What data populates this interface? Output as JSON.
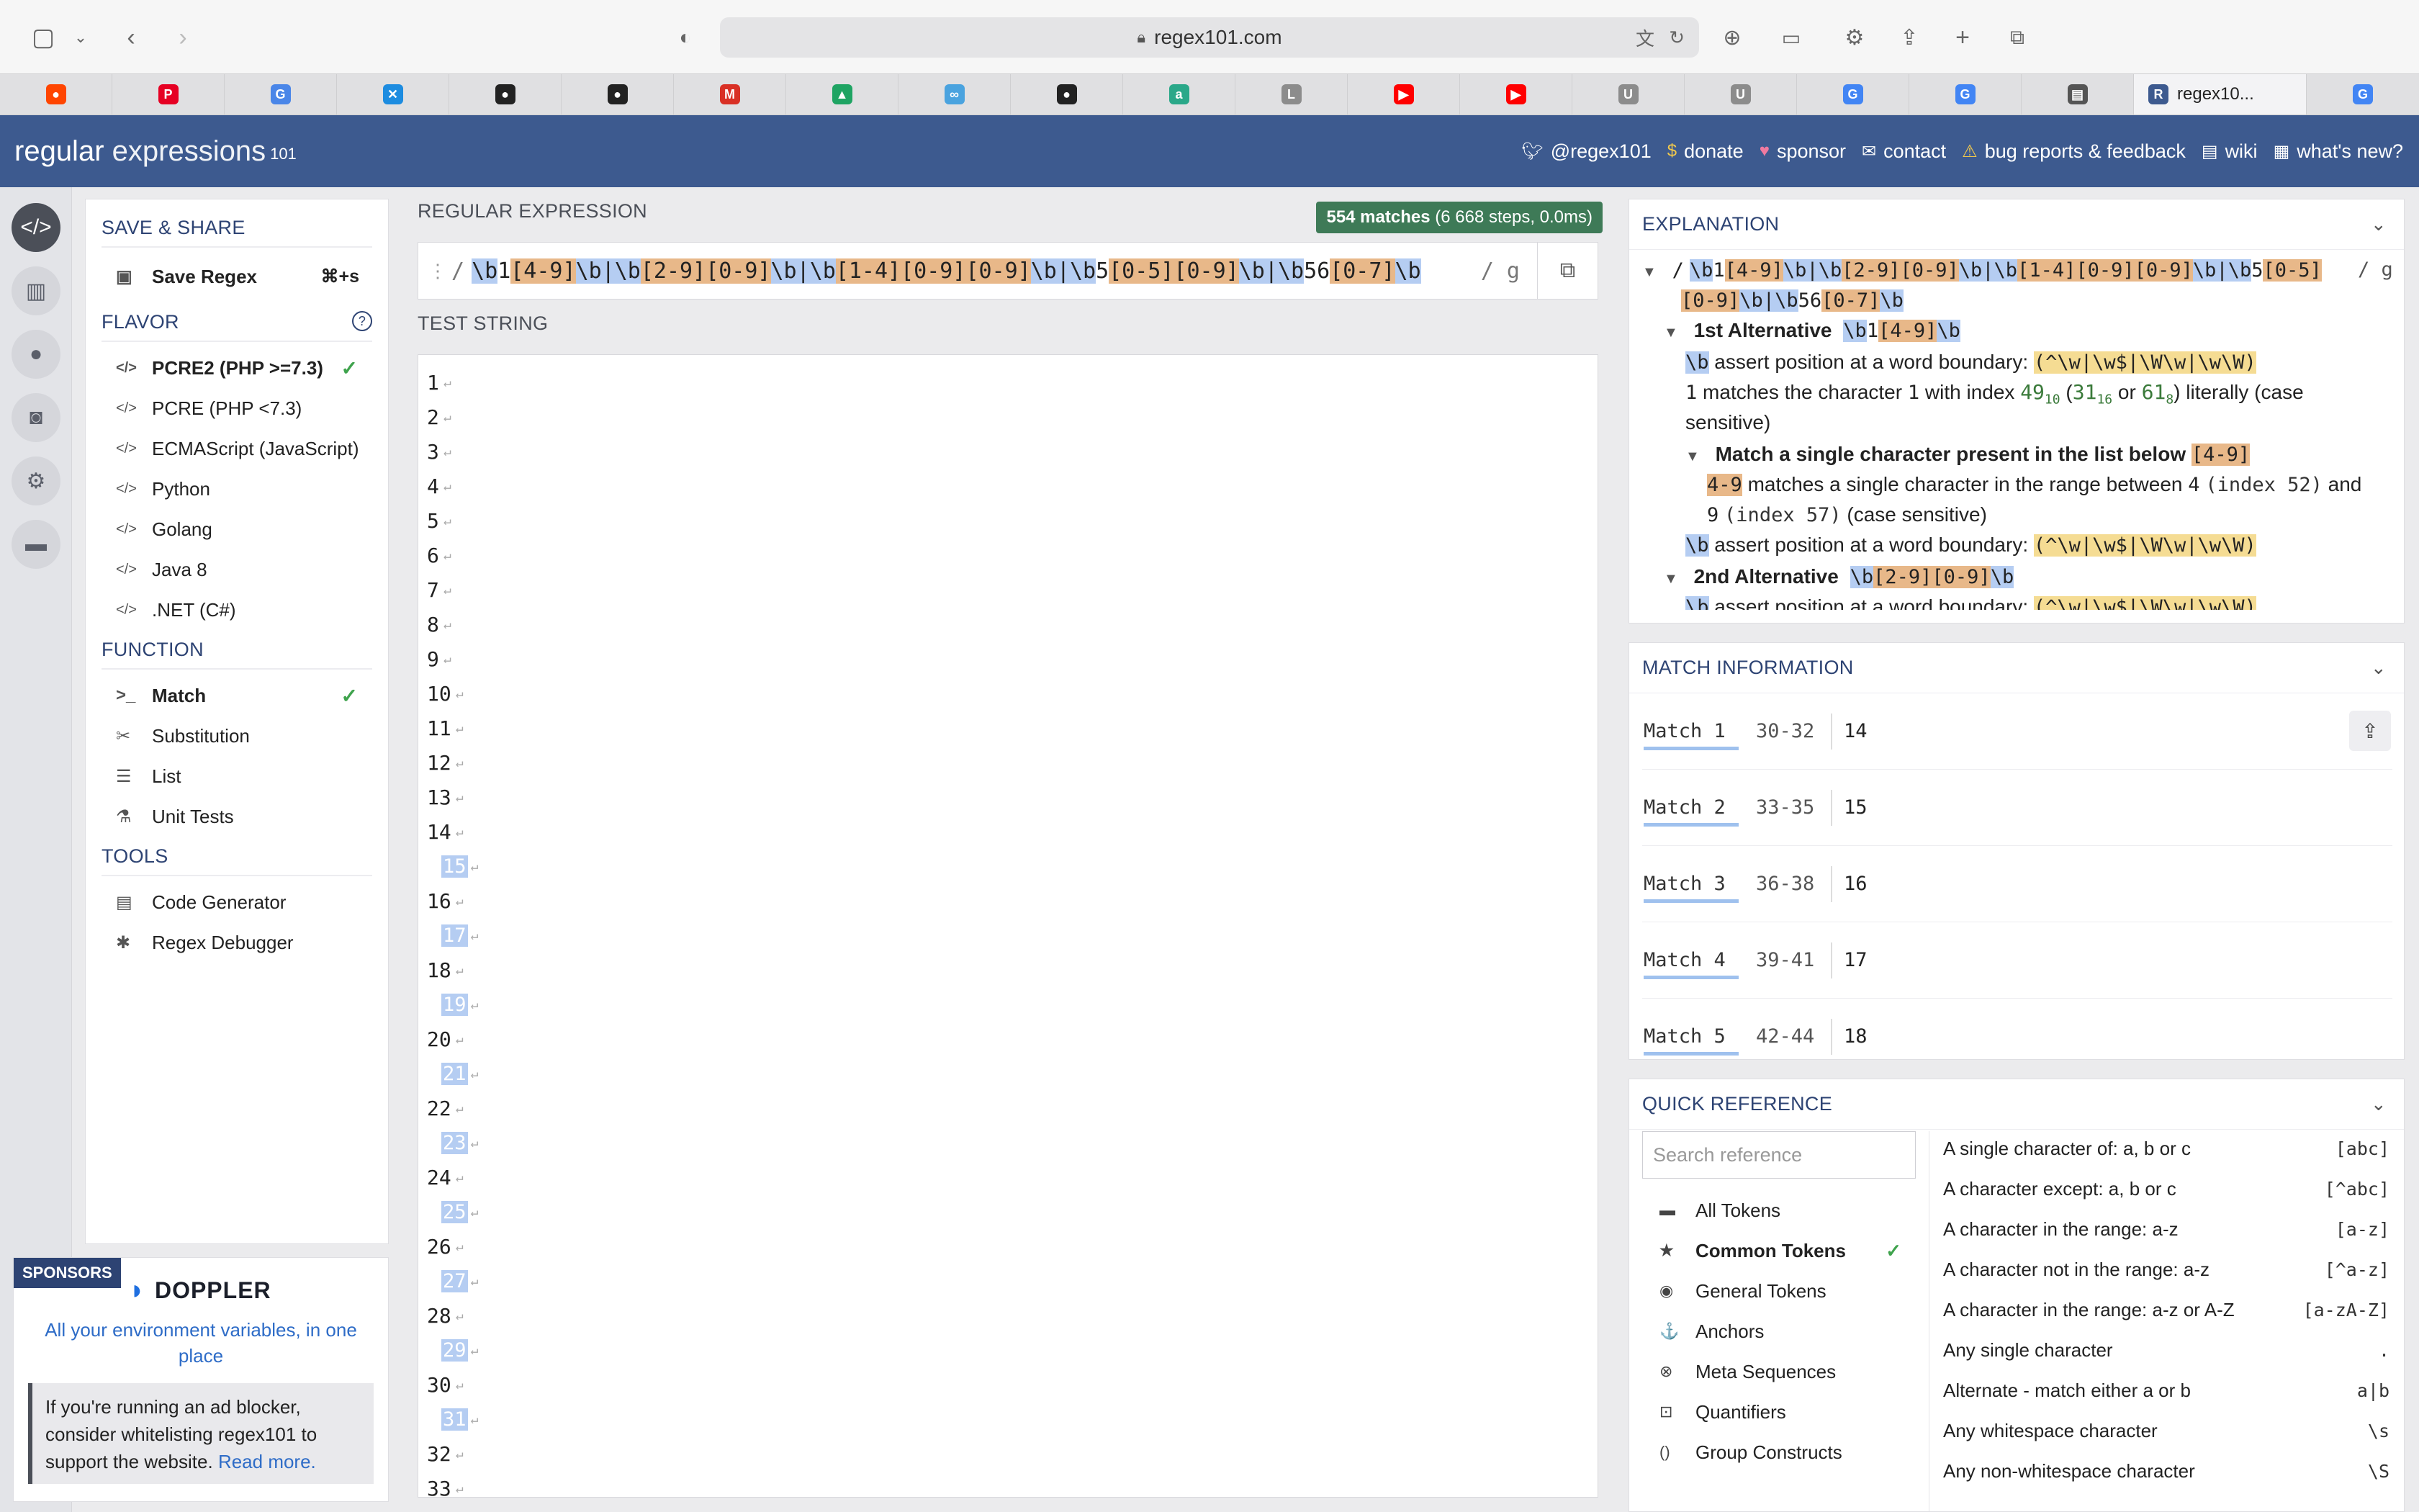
{
  "browser": {
    "url": "regex101.com",
    "active_tab_label": "regex10...",
    "tabs": [
      {
        "icon": "reddit-icon",
        "color": "#ff4500",
        "glyph": "●"
      },
      {
        "icon": "pinterest-icon",
        "color": "#e60023",
        "glyph": "P"
      },
      {
        "icon": "translate-icon",
        "color": "#4a86e8",
        "glyph": "G"
      },
      {
        "icon": "close-circle-icon",
        "color": "#1d8ce0",
        "glyph": "✕"
      },
      {
        "icon": "github-icon",
        "color": "#222222",
        "glyph": "●"
      },
      {
        "icon": "github-icon",
        "color": "#222222",
        "glyph": "●"
      },
      {
        "icon": "gmail-icon",
        "color": "#d93025",
        "glyph": "M"
      },
      {
        "icon": "drive-icon",
        "color": "#1fa463",
        "glyph": "▲"
      },
      {
        "icon": "link-icon",
        "color": "#4aa3df",
        "glyph": "∞"
      },
      {
        "icon": "github-icon",
        "color": "#222222",
        "glyph": "●"
      },
      {
        "icon": "app-icon",
        "color": "#2aa889",
        "glyph": "a"
      },
      {
        "icon": "letter-l-icon",
        "color": "#8c8c8c",
        "glyph": "L"
      },
      {
        "icon": "youtube-icon",
        "color": "#ff0000",
        "glyph": "▶"
      },
      {
        "icon": "youtube-icon",
        "color": "#ff0000",
        "glyph": "▶"
      },
      {
        "icon": "letter-u-icon",
        "color": "#8c8c8c",
        "glyph": "U"
      },
      {
        "icon": "letter-u-icon",
        "color": "#8c8c8c",
        "glyph": "U"
      },
      {
        "icon": "google-icon",
        "color": "#4285f4",
        "glyph": "G"
      },
      {
        "icon": "google-icon",
        "color": "#4285f4",
        "glyph": "G"
      },
      {
        "icon": "document-icon",
        "color": "#555555",
        "glyph": "▤"
      }
    ],
    "trailing_tab": {
      "icon": "google-icon",
      "color": "#4285f4",
      "glyph": "G"
    }
  },
  "header": {
    "logo_bold": "regular",
    "logo_rest": "expressions",
    "logo_sup": "101",
    "links": [
      {
        "icon": "twitter-icon",
        "label": "@regex101"
      },
      {
        "icon": "dollar-icon",
        "label": "donate"
      },
      {
        "icon": "heart-icon",
        "label": "sponsor"
      },
      {
        "icon": "mail-icon",
        "label": "contact"
      },
      {
        "icon": "warning-icon",
        "label": "bug reports & feedback"
      },
      {
        "icon": "wiki-icon",
        "label": "wiki"
      },
      {
        "icon": "news-icon",
        "label": "what's new?"
      }
    ]
  },
  "left_panel": {
    "save_title": "SAVE & SHARE",
    "save_regex": "Save Regex",
    "save_shortcut": "⌘+s",
    "flavor_title": "FLAVOR",
    "flavors": [
      "PCRE2 (PHP >=7.3)",
      "PCRE (PHP <7.3)",
      "ECMAScript (JavaScript)",
      "Python",
      "Golang",
      "Java 8",
      ".NET (C#)"
    ],
    "function_title": "FUNCTION",
    "functions": [
      "Match",
      "Substitution",
      "List",
      "Unit Tests"
    ],
    "tools_title": "TOOLS",
    "tools": [
      "Code Generator",
      "Regex Debugger"
    ]
  },
  "sponsor": {
    "badge": "SPONSORS",
    "name": "DOPPLER",
    "tagline": "All your environment variables, in one place",
    "adblock_text": "If you're running an ad blocker, consider whitelisting regex101 to support the website.",
    "adblock_link": "Read more."
  },
  "regex": {
    "label": "REGULAR EXPRESSION",
    "matches_count": "554 matches",
    "matches_detail": "(6 668 steps, 0.0ms)",
    "delimiter": "/",
    "flags": "/ g",
    "pattern_tokens": [
      {
        "t": "\\b",
        "c": "b"
      },
      {
        "t": "1",
        "c": ""
      },
      {
        "t": "[4-9]",
        "c": "c"
      },
      {
        "t": "\\b",
        "c": "b"
      },
      {
        "t": "|",
        "c": "b"
      },
      {
        "t": "\\b",
        "c": "b"
      },
      {
        "t": "[2-9]",
        "c": "c"
      },
      {
        "t": "[0-9]",
        "c": "c"
      },
      {
        "t": "\\b",
        "c": "b"
      },
      {
        "t": "|",
        "c": "b"
      },
      {
        "t": "\\b",
        "c": "b"
      },
      {
        "t": "[1-4]",
        "c": "c"
      },
      {
        "t": "[0-9]",
        "c": "c"
      },
      {
        "t": "[0-9]",
        "c": "c"
      },
      {
        "t": "\\b",
        "c": "b"
      },
      {
        "t": "|",
        "c": "b"
      },
      {
        "t": "\\b",
        "c": "b"
      },
      {
        "t": "5",
        "c": ""
      },
      {
        "t": "[0-5]",
        "c": "c"
      },
      {
        "t": "[0-9]",
        "c": "c"
      },
      {
        "t": "\\b",
        "c": "b"
      },
      {
        "t": "|",
        "c": "b"
      },
      {
        "t": "\\b",
        "c": "b"
      },
      {
        "t": "56",
        "c": ""
      },
      {
        "t": "[0-7]",
        "c": "c"
      },
      {
        "t": "\\b",
        "c": "b"
      }
    ]
  },
  "test_string": {
    "label": "TEST STRING",
    "lines": [
      "1",
      "2",
      "3",
      "4",
      "5",
      "6",
      "7",
      "8",
      "9",
      "10",
      "11",
      "12",
      "13",
      "14",
      "15",
      "16",
      "17",
      "18",
      "19",
      "20",
      "21",
      "22",
      "23",
      "24",
      "25",
      "26",
      "27",
      "28",
      "29",
      "30",
      "31",
      "32",
      "33"
    ],
    "highlighted": [
      "15",
      "17",
      "19",
      "21",
      "23",
      "25",
      "27",
      "29",
      "31"
    ]
  },
  "explanation": {
    "title": "EXPLANATION",
    "line1_tokens_a": [
      {
        "t": "\\b",
        "c": "b"
      },
      {
        "t": "1",
        "c": ""
      },
      {
        "t": "[4-9]",
        "c": "c"
      },
      {
        "t": "\\b",
        "c": "b"
      },
      {
        "t": "|",
        "c": "b"
      },
      {
        "t": "\\b",
        "c": "b"
      },
      {
        "t": "[2-9]",
        "c": "c"
      },
      {
        "t": "[0-9]",
        "c": "c"
      },
      {
        "t": "\\b",
        "c": "b"
      },
      {
        "t": "|",
        "c": "b"
      },
      {
        "t": "\\b",
        "c": "b"
      },
      {
        "t": "[1-4]",
        "c": "c"
      },
      {
        "t": "[0-9]",
        "c": "c"
      },
      {
        "t": "[0-9]",
        "c": "c"
      },
      {
        "t": "\\b",
        "c": "b"
      },
      {
        "t": "|",
        "c": "b"
      },
      {
        "t": "\\b",
        "c": "b"
      },
      {
        "t": "5",
        "c": ""
      },
      {
        "t": "[0-5]",
        "c": "c"
      }
    ],
    "line1_tokens_b": [
      {
        "t": "[0-9]",
        "c": "c"
      },
      {
        "t": "\\b",
        "c": "b"
      },
      {
        "t": "|",
        "c": "b"
      },
      {
        "t": "\\b",
        "c": "b"
      },
      {
        "t": "56",
        "c": ""
      },
      {
        "t": "[0-7]",
        "c": "c"
      },
      {
        "t": "\\b",
        "c": "b"
      }
    ],
    "flags": "/ g",
    "alt1_title": "1st Alternative",
    "alt1_tokens": [
      {
        "t": "\\b",
        "c": "b"
      },
      {
        "t": "1",
        "c": ""
      },
      {
        "t": "[4-9]",
        "c": "c"
      },
      {
        "t": "\\b",
        "c": "b"
      }
    ],
    "wb_token": "\\b",
    "wb_text": "assert position at a word boundary:",
    "wb_expr": "(^\\w|\\w$|\\W\\w|\\w\\W)",
    "lit_char": "1",
    "lit_text_a": "matches the character",
    "lit_char2": "1",
    "lit_text_b": "with index",
    "lit_dec": "49",
    "lit_dec_sub": "10",
    "lit_hex": "31",
    "lit_hex_sub": "16",
    "lit_or": "or",
    "lit_oct": "61",
    "lit_oct_sub": "8",
    "lit_text_c": "literally (case",
    "lit_text_d": "sensitive)",
    "list_title": "Match a single character present in the list below",
    "list_token": "[4-9]",
    "range_token": "4-9",
    "range_text_a": "matches a single character in the range between",
    "range_from": "4",
    "range_from_idx": "(index 52)",
    "range_and": "and",
    "range_to": "9",
    "range_to_idx": "(index 57)",
    "range_case": "(case sensitive)",
    "alt2_title": "2nd Alternative",
    "alt2_tokens": [
      {
        "t": "\\b",
        "c": "b"
      },
      {
        "t": "[2-9]",
        "c": "c"
      },
      {
        "t": "[0-9]",
        "c": "c"
      },
      {
        "t": "\\b",
        "c": "b"
      }
    ]
  },
  "match_info": {
    "title": "MATCH INFORMATION",
    "rows": [
      {
        "name": "Match 1",
        "range": "30-32",
        "value": "14"
      },
      {
        "name": "Match 2",
        "range": "33-35",
        "value": "15"
      },
      {
        "name": "Match 3",
        "range": "36-38",
        "value": "16"
      },
      {
        "name": "Match 4",
        "range": "39-41",
        "value": "17"
      },
      {
        "name": "Match 5",
        "range": "42-44",
        "value": "18"
      }
    ]
  },
  "quick_ref": {
    "title": "QUICK REFERENCE",
    "search_placeholder": "Search reference",
    "categories": [
      {
        "icon": "stack-icon",
        "glyph": "▬",
        "label": "All Tokens"
      },
      {
        "icon": "star-icon",
        "glyph": "★",
        "label": "Common Tokens"
      },
      {
        "icon": "target-icon",
        "glyph": "◉",
        "label": "General Tokens"
      },
      {
        "icon": "anchor-icon",
        "glyph": "⚓",
        "label": "Anchors"
      },
      {
        "icon": "meta-icon",
        "glyph": "⊗",
        "label": "Meta Sequences"
      },
      {
        "icon": "quantifier-icon",
        "glyph": "⊡",
        "label": "Quantifiers"
      },
      {
        "icon": "parens-icon",
        "glyph": "()",
        "label": "Group Constructs"
      }
    ],
    "refs": [
      {
        "desc": "A single character of: a, b or c",
        "token": "[abc]"
      },
      {
        "desc": "A character except: a, b or c",
        "token": "[^abc]"
      },
      {
        "desc": "A character in the range: a-z",
        "token": "[a-z]"
      },
      {
        "desc": "A character not in the range: a-z",
        "token": "[^a-z]"
      },
      {
        "desc": "A character in the range: a-z or A-Z",
        "token": "[a-zA-Z]"
      },
      {
        "desc": "Any single character",
        "token": "."
      },
      {
        "desc": "Alternate - match either a or b",
        "token": "a|b"
      },
      {
        "desc": "Any whitespace character",
        "token": "\\s"
      },
      {
        "desc": "Any non-whitespace character",
        "token": "\\S"
      }
    ]
  }
}
